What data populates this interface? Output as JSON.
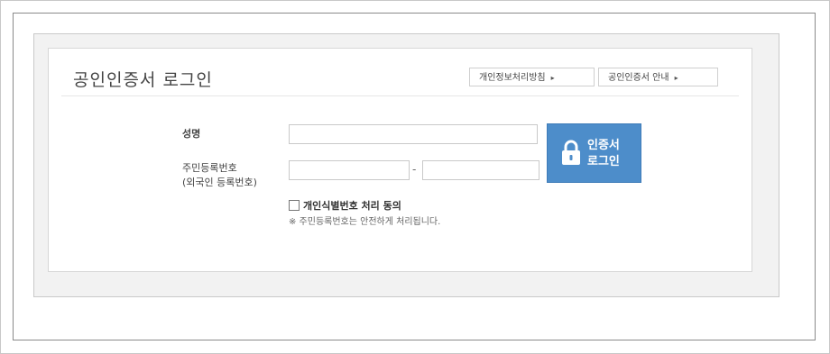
{
  "panel": {
    "title": "공인인증서 로그인",
    "privacy_button": "개인정보처리방침",
    "guide_button": "공인인증서 안내",
    "arrow_glyph": "▸"
  },
  "form": {
    "name_label": "성명",
    "rrn_label": "주민등록번호",
    "rrn_sub_label": "(외국인 등록번호)",
    "name_value": "",
    "rrn_front_value": "",
    "rrn_back_value": "",
    "separator": "-"
  },
  "login_button": {
    "line1": "인증서",
    "line2": "로그인",
    "icon": "lock-icon",
    "color": "#4d8dca"
  },
  "consent": {
    "label": "개인식별번호 처리 동의",
    "checked": false,
    "note": "※ 주민등록번호는 안전하게 처리됩니다."
  }
}
